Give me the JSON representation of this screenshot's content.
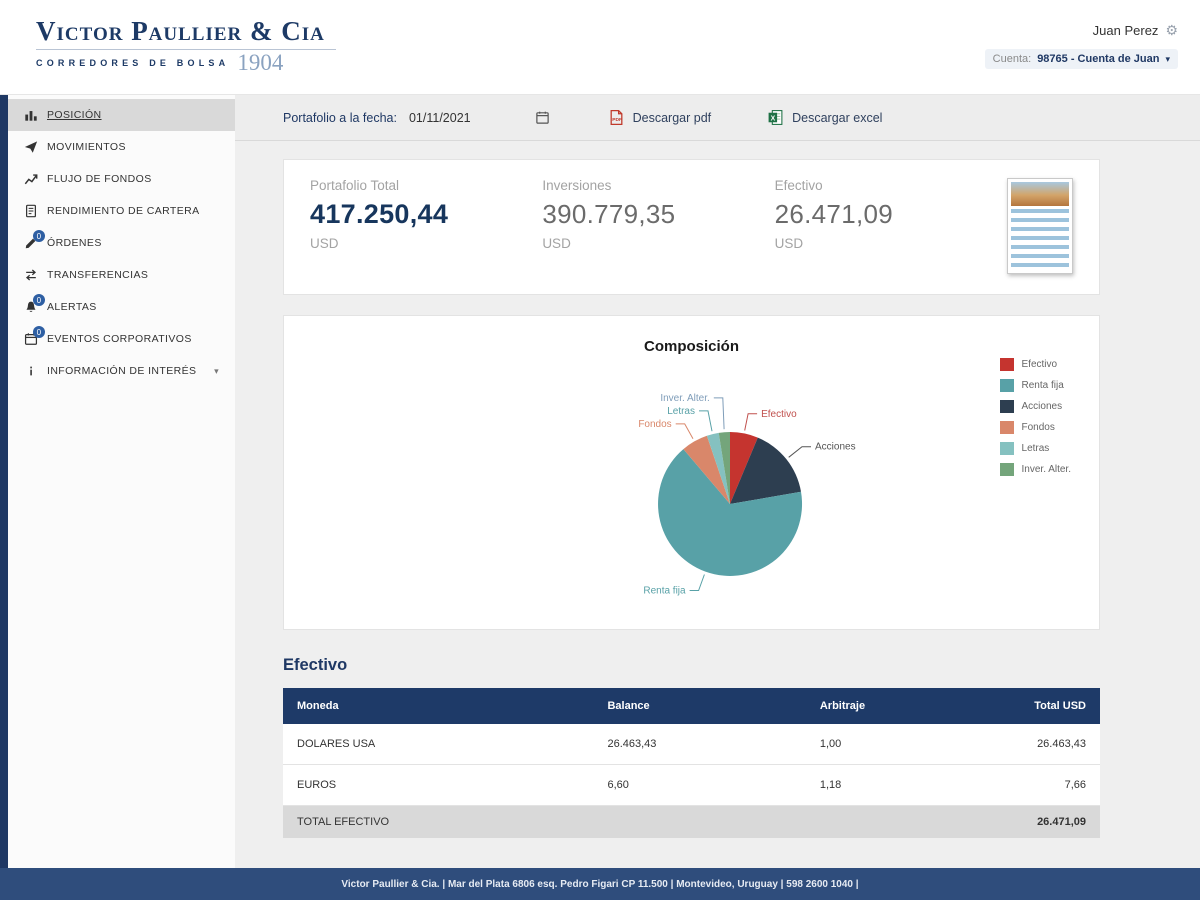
{
  "header": {
    "logo": {
      "line1": "Victor Paullier & Cia",
      "line2": "CORREDORES DE BOLSA",
      "year": "1904"
    },
    "user": {
      "name": "Juan Perez"
    },
    "account": {
      "label": "Cuenta:",
      "value": "98765 - Cuenta de Juan"
    }
  },
  "sidebar": {
    "items": [
      {
        "label": "POSICIÓN",
        "icon": "position",
        "active": true
      },
      {
        "label": "MOVIMIENTOS",
        "icon": "send"
      },
      {
        "label": "FLUJO DE FONDOS",
        "icon": "chart-line"
      },
      {
        "label": "RENDIMIENTO DE CARTERA",
        "icon": "document"
      },
      {
        "label": "ÓRDENES",
        "icon": "pencil",
        "badge": "0"
      },
      {
        "label": "TRANSFERENCIAS",
        "icon": "transfer"
      },
      {
        "label": "ALERTAS",
        "icon": "bell",
        "badge": "0"
      },
      {
        "label": "EVENTOS CORPORATIVOS",
        "icon": "calendar",
        "badge": "0"
      },
      {
        "label": "INFORMACIÓN DE INTERÉS",
        "icon": "info",
        "chevron": true
      }
    ]
  },
  "toolbar": {
    "date_label": "Portafolio a la fecha:",
    "date_value": "01/11/2021",
    "pdf_label": "Descargar pdf",
    "excel_label": "Descargar excel"
  },
  "summary": {
    "cards": [
      {
        "label": "Portafolio Total",
        "value": "417.250,44",
        "currency": "USD",
        "emphasis": true
      },
      {
        "label": "Inversiones",
        "value": "390.779,35",
        "currency": "USD",
        "emphasis": false
      },
      {
        "label": "Efectivo",
        "value": "26.471,09",
        "currency": "USD",
        "emphasis": false
      }
    ]
  },
  "chart_data": {
    "type": "pie",
    "title": "Composición",
    "unit": "percent_of_portfolio",
    "slices": [
      {
        "label": "Efectivo",
        "value": 6.3,
        "color": "#c5342f",
        "label_color": "#c0504d"
      },
      {
        "label": "Acciones",
        "value": 16.0,
        "color": "#2d3e50",
        "label_color": "#555555"
      },
      {
        "label": "Renta fija",
        "value": 66.5,
        "color": "#58a1a7",
        "label_color": "#58a1a7"
      },
      {
        "label": "Fondos",
        "value": 6.0,
        "color": "#d9876a",
        "label_color": "#d9876a"
      },
      {
        "label": "Letras",
        "value": 2.7,
        "color": "#85c1c0",
        "label_color": "#58a1a7"
      },
      {
        "label": "Inver. Alter.",
        "value": 2.5,
        "color": "#74a57b",
        "label_color": "#7f9db9"
      }
    ],
    "legend": [
      {
        "label": "Efectivo",
        "color": "#c5342f"
      },
      {
        "label": "Renta fija",
        "color": "#58a1a7"
      },
      {
        "label": "Acciones",
        "color": "#2d3e50"
      },
      {
        "label": "Fondos",
        "color": "#d9876a"
      },
      {
        "label": "Letras",
        "color": "#85c1c0"
      },
      {
        "label": "Inver. Alter.",
        "color": "#74a57b"
      }
    ],
    "legend_position": "right",
    "labels_outside": true
  },
  "efectivo": {
    "title": "Efectivo",
    "table": {
      "columns": [
        "Moneda",
        "Balance",
        "Arbitraje",
        "Total USD"
      ],
      "rows": [
        [
          "DOLARES USA",
          "26.463,43",
          "1,00",
          "26.463,43"
        ],
        [
          "EUROS",
          "6,60",
          "1,18",
          "7,66"
        ]
      ],
      "footer": {
        "label": "TOTAL EFECTIVO",
        "total": "26.471,09"
      }
    }
  },
  "footer": {
    "text": "Victor Paullier & Cia. | Mar del Plata 6806 esq. Pedro Figari CP 11.500 | Montevideo, Uruguay | 598 2600 1040 |"
  },
  "colors": {
    "brand_navy": "#1f3864",
    "table_header": "#1e3a68",
    "footer_bar": "#2f4d7c",
    "badge_blue": "#2e5fa3"
  }
}
